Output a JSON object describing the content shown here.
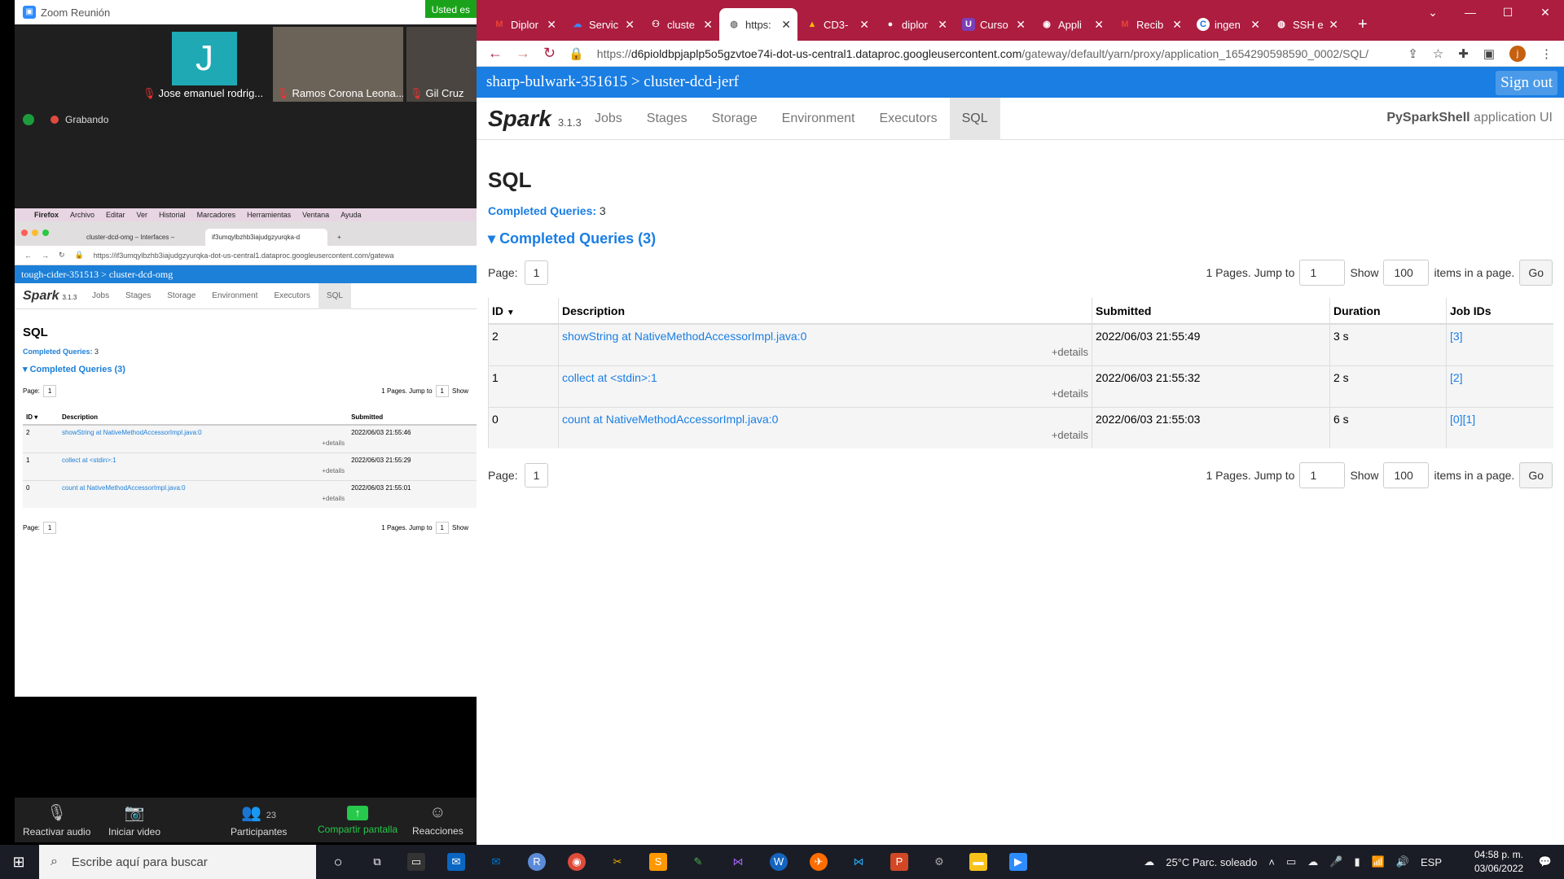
{
  "zoom": {
    "title": "Zoom Reunión",
    "banner": "Usted es",
    "participants": [
      "Jose emanuel rodrig...",
      "Ramos Corona Leona...",
      "Gil Cruz"
    ],
    "avatar_letter": "J",
    "recording": "Grabando",
    "toolbar": {
      "audio": "Reactivar audio",
      "video": "Iniciar video",
      "participants": "Participantes",
      "participants_count": "23",
      "share": "Compartir pantalla",
      "reactions": "Reacciones"
    }
  },
  "shared": {
    "menu": [
      "Firefox",
      "Archivo",
      "Editar",
      "Ver",
      "Historial",
      "Marcadores",
      "Herramientas",
      "Ventana",
      "Ayuda"
    ],
    "tabs": [
      "cluster-dcd-omg – Interfaces –",
      "if3umqylbzhb3iajudgzyurqka-d"
    ],
    "url": "https://if3umqylbzhb3iajudgzyurqka-dot-us-central1.dataproc.googleusercontent.com/gatewa",
    "breadcrumb": "tough-cider-351513 > cluster-dcd-omg",
    "spark_version": "3.1.3",
    "nav": [
      "Jobs",
      "Stages",
      "Storage",
      "Environment",
      "Executors",
      "SQL"
    ],
    "heading": "SQL",
    "completed_label": "Completed Queries:",
    "completed_count": "3",
    "section": "Completed Queries (3)",
    "page_label": "Page:",
    "page_num": "1",
    "pages_text": "1 Pages. Jump to",
    "show": "Show",
    "headers": [
      "ID",
      "Description",
      "Submitted"
    ],
    "rows": [
      {
        "id": "2",
        "desc": "showString at NativeMethodAccessorImpl.java:0",
        "submitted": "2022/06/03 21:55:46"
      },
      {
        "id": "1",
        "desc": "collect at <stdin>:1",
        "submitted": "2022/06/03 21:55:29"
      },
      {
        "id": "0",
        "desc": "count at NativeMethodAccessorImpl.java:0",
        "submitted": "2022/06/03 21:55:01"
      }
    ],
    "details": "+details"
  },
  "chrome": {
    "tabs": [
      "Diplor",
      "Servic",
      "cluste",
      "https:",
      "CD3-",
      "diplor",
      "Curso",
      "Appli",
      "Recib",
      "ingen",
      "SSH e"
    ],
    "url_prefix": "https://",
    "url_host": "d6pioldbpjaplp5o5gzvtoe74i-dot-us-central1.dataproc.googleusercontent.com",
    "url_path": "/gateway/default/yarn/proxy/application_1654290598590_0002/SQL/",
    "profile": "j"
  },
  "spark": {
    "breadcrumb": "sharp-bulwark-351615 > cluster-dcd-jerf",
    "sign_out": "Sign out",
    "version": "3.1.3",
    "nav": [
      "Jobs",
      "Stages",
      "Storage",
      "Environment",
      "Executors",
      "SQL"
    ],
    "app_name": "PySparkShell",
    "app_suffix": "application UI",
    "heading": "SQL",
    "completed_label": "Completed Queries:",
    "completed_count": "3",
    "section": "Completed Queries (3)",
    "page_label": "Page:",
    "page_num": "1",
    "pages_text": "1 Pages. Jump to",
    "jump_value": "1",
    "show": "Show",
    "show_value": "100",
    "items_text": "items in a page.",
    "go": "Go",
    "headers": {
      "id": "ID",
      "description": "Description",
      "submitted": "Submitted",
      "duration": "Duration",
      "jobs": "Job IDs"
    },
    "rows": [
      {
        "id": "2",
        "desc": "showString at NativeMethodAccessorImpl.java:0",
        "submitted": "2022/06/03 21:55:49",
        "duration": "3 s",
        "jobs": "[3]"
      },
      {
        "id": "1",
        "desc": "collect at <stdin>:1",
        "submitted": "2022/06/03 21:55:32",
        "duration": "2 s",
        "jobs": "[2]"
      },
      {
        "id": "0",
        "desc": "count at NativeMethodAccessorImpl.java:0",
        "submitted": "2022/06/03 21:55:03",
        "duration": "6 s",
        "jobs": "[0][1]"
      }
    ],
    "details": "+details"
  },
  "taskbar": {
    "search": "Escribe aquí para buscar",
    "weather": "25°C  Parc. soleado",
    "lang": "ESP",
    "time": "04:58 p. m.",
    "date": "03/06/2022"
  }
}
